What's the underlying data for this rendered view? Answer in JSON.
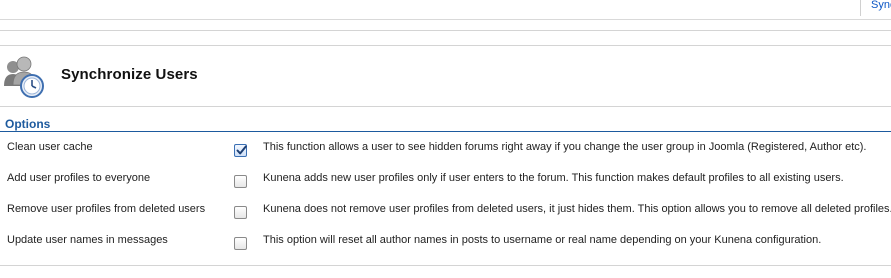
{
  "toolbar": {
    "sync_tab_label": "Sync"
  },
  "header": {
    "title": "Synchronize Users",
    "icon": "users-sync-icon"
  },
  "options": {
    "section_title": "Options",
    "rows": [
      {
        "label": "Clean user cache",
        "checked": true,
        "description": "This function allows a user to see hidden forums right away if you change the user group in Joomla (Registered, Author etc)."
      },
      {
        "label": "Add user profiles to everyone",
        "checked": false,
        "description": "Kunena adds new user profiles only if user enters to the forum. This function makes default profiles to all existing users."
      },
      {
        "label": "Remove user profiles from deleted users",
        "checked": false,
        "description": "Kunena does not remove user profiles from deleted users, it just hides them. This option allows you to remove all deleted profiles."
      },
      {
        "label": "Update user names in messages",
        "checked": false,
        "description": "This option will reset all author names in posts to username or real name depending on your Kunena configuration."
      }
    ]
  },
  "colors": {
    "accent": "#1d5a9e",
    "link": "#0b55c4"
  }
}
